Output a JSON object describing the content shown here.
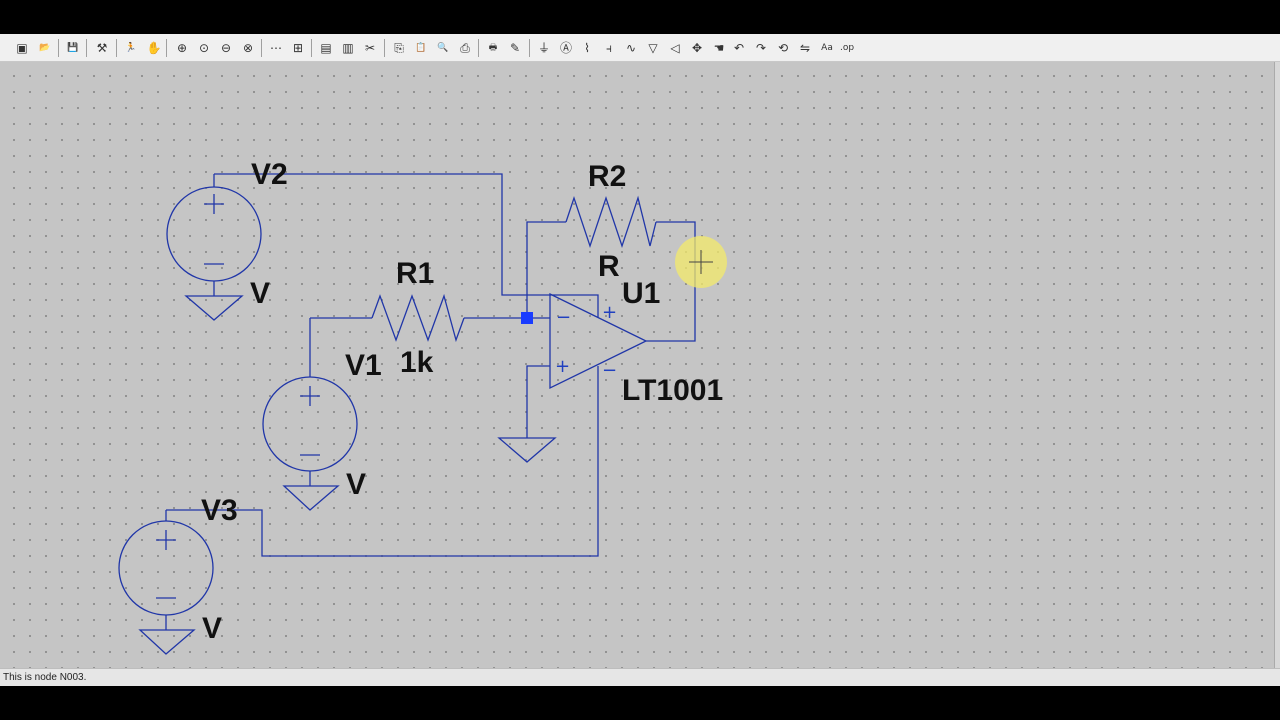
{
  "toolbar": {
    "buttons": [
      {
        "name": "new-schematic-icon",
        "glyph": "▣"
      },
      {
        "name": "open-icon",
        "glyph": "📂"
      },
      {
        "name": "save-icon",
        "glyph": "💾"
      },
      {
        "name": "control-panel-icon",
        "glyph": "⚒"
      },
      {
        "name": "run-icon",
        "glyph": "🏃"
      },
      {
        "name": "halt-icon",
        "glyph": "✋"
      },
      {
        "name": "zoom-in-icon",
        "glyph": "⊕"
      },
      {
        "name": "pan-icon",
        "glyph": "⊙"
      },
      {
        "name": "zoom-out-icon",
        "glyph": "⊖"
      },
      {
        "name": "zoom-fit-icon",
        "glyph": "⊗"
      },
      {
        "name": "autoscale-icon",
        "glyph": "⋯"
      },
      {
        "name": "tile-icon",
        "glyph": "⊞"
      },
      {
        "name": "cascade-icon",
        "glyph": "▤"
      },
      {
        "name": "close-window-icon",
        "glyph": "▥"
      },
      {
        "name": "cut-icon",
        "glyph": "✂"
      },
      {
        "name": "copy-icon",
        "glyph": "⎘"
      },
      {
        "name": "paste-icon",
        "glyph": "📋"
      },
      {
        "name": "find-icon",
        "glyph": "🔍"
      },
      {
        "name": "print-setup-icon",
        "glyph": "⎙"
      },
      {
        "name": "print-icon",
        "glyph": "🖶"
      },
      {
        "name": "draw-wire-icon",
        "glyph": "✎"
      },
      {
        "name": "ground-icon",
        "glyph": "⏚"
      },
      {
        "name": "label-net-icon",
        "glyph": "Ⓐ"
      },
      {
        "name": "resistor-icon",
        "glyph": "⌇"
      },
      {
        "name": "capacitor-icon",
        "glyph": "⫞"
      },
      {
        "name": "inductor-icon",
        "glyph": "∿"
      },
      {
        "name": "diode-icon",
        "glyph": "▽"
      },
      {
        "name": "component-icon",
        "glyph": "◁"
      },
      {
        "name": "move-icon",
        "glyph": "✥"
      },
      {
        "name": "drag-icon",
        "glyph": "☚"
      },
      {
        "name": "undo-icon",
        "glyph": "↶"
      },
      {
        "name": "redo-icon",
        "glyph": "↷"
      },
      {
        "name": "rotate-icon",
        "glyph": "⟲"
      },
      {
        "name": "mirror-icon",
        "glyph": "⇋"
      },
      {
        "name": "text-icon",
        "glyph": "Aa"
      },
      {
        "name": "spice-directive-icon",
        "glyph": ".op"
      }
    ]
  },
  "schematic": {
    "labels": {
      "v2": "V2",
      "v2_value": "V",
      "r2": "R2",
      "r2_value": "R",
      "u1": "U1",
      "r1": "R1",
      "r1_value": "1k",
      "v1": "V1",
      "v1_value": "V",
      "lt1001": "LT1001",
      "v3": "V3",
      "v3_value": "V"
    },
    "plus": "+",
    "minus": "−"
  },
  "status": {
    "text": "This is node N003."
  }
}
